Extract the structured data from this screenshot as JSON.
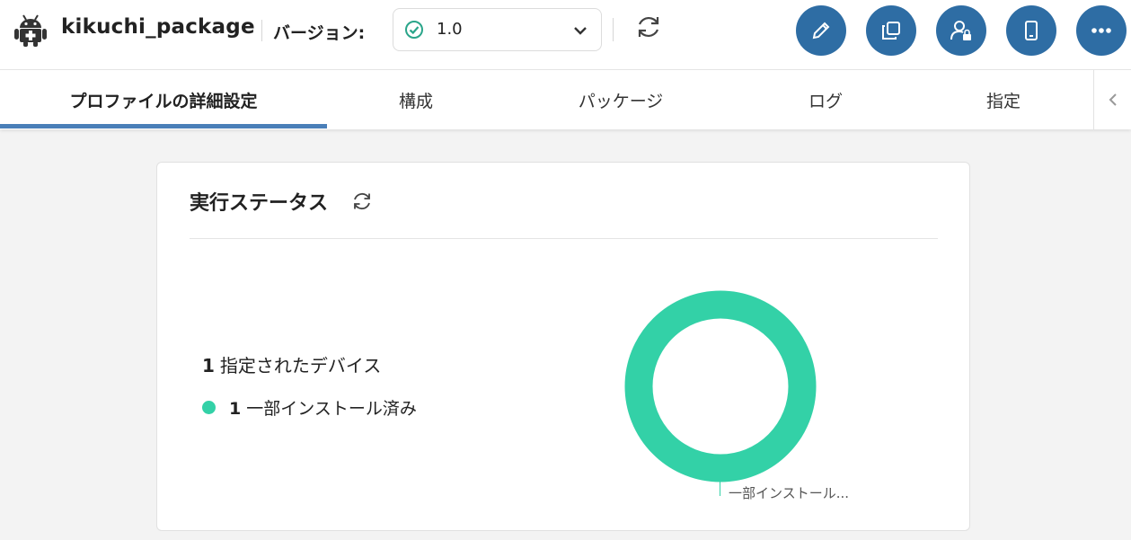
{
  "header": {
    "package_name": "kikuchi_package",
    "version_label": "バージョン:",
    "version_value": "1.0",
    "icons": [
      "android-icon",
      "check-circle-icon",
      "chevron-down-icon",
      "refresh-icon"
    ],
    "actions": [
      "edit",
      "copy",
      "user-lock",
      "device",
      "more"
    ]
  },
  "tabs": [
    {
      "label": "プロファイルの詳細設定",
      "active": true
    },
    {
      "label": "構成",
      "active": false
    },
    {
      "label": "パッケージ",
      "active": false
    },
    {
      "label": "ログ",
      "active": false
    },
    {
      "label": "指定",
      "active": false
    }
  ],
  "status_card": {
    "title": "実行ステータス",
    "assigned_count": "1",
    "assigned_label": "指定されたデバイス",
    "legend": [
      {
        "count": "1",
        "label": "一部インストール済み",
        "color": "#33d1a7"
      }
    ],
    "donut_label": "一部インストール..."
  },
  "colors": {
    "accent": "#2e6da4",
    "tab_indicator": "#4a7fb8",
    "partial_install": "#33d1a7"
  }
}
